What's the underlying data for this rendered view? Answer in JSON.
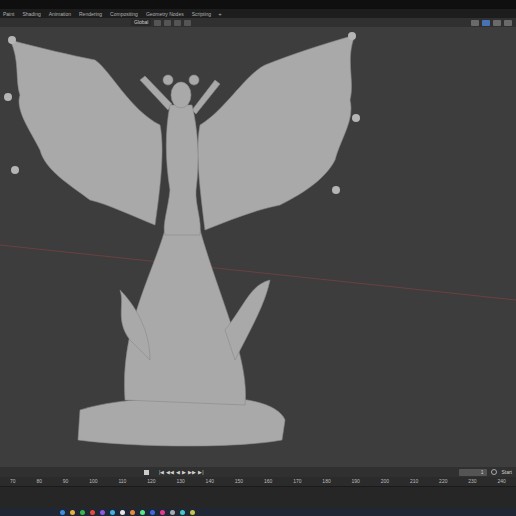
{
  "workspace_tabs": [
    {
      "label": "Paint",
      "selected": false
    },
    {
      "label": "Shading",
      "selected": false
    },
    {
      "label": "Animation",
      "selected": false
    },
    {
      "label": "Rendering",
      "selected": false
    },
    {
      "label": "Compositing",
      "selected": false
    },
    {
      "label": "Geometry Nodes",
      "selected": false
    },
    {
      "label": "Scripting",
      "selected": false
    }
  ],
  "add_tab": "+",
  "header": {
    "orientation": "Global"
  },
  "timeline": {
    "transport": [
      "|◀",
      "◀◀",
      "◀",
      "▶",
      "▶▶",
      "▶|"
    ],
    "current_frame": "1",
    "start_label": "Start",
    "ticks": [
      "70",
      "80",
      "90",
      "100",
      "110",
      "120",
      "130",
      "140",
      "150",
      "160",
      "170",
      "180",
      "190",
      "200",
      "210",
      "220",
      "230",
      "240"
    ]
  }
}
